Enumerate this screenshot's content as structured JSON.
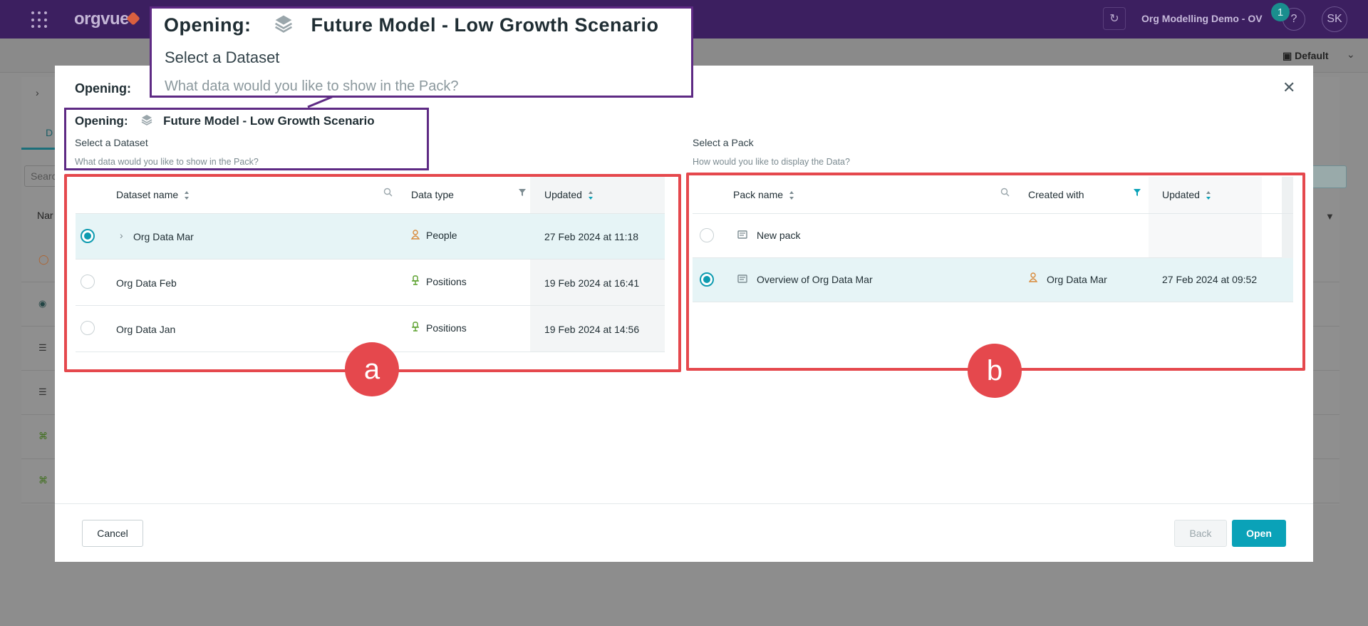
{
  "topbar": {
    "logo": "orgvue",
    "org_name": "Org Modelling Demo - OV",
    "notification_count": "1",
    "help_label": "?",
    "user_initials": "SK",
    "view_label": "Default",
    "colors": {
      "bar": "#3c1f60",
      "accent": "#0aa2b8"
    }
  },
  "background": {
    "tab_label": "D",
    "search_placeholder": "Searc",
    "column_name": "Nar"
  },
  "modal": {
    "title": "Opening:",
    "opening_label": "Opening:",
    "model_name": "Future Model - Low Growth Scenario",
    "dataset_section": {
      "title": "Select a Dataset",
      "subtitle": "What data would you like to show in the Pack?"
    },
    "pack_section": {
      "title": "Select a Pack",
      "subtitle": "How would you like to display the Data?"
    },
    "dataset_table": {
      "headers": {
        "name": "Dataset name",
        "type": "Data type",
        "updated": "Updated"
      },
      "rows": [
        {
          "name": "Org Data Mar",
          "type": "People",
          "type_icon": "person-icon",
          "updated": "27 Feb 2024 at 11:18",
          "selected": true,
          "expandable": true
        },
        {
          "name": "Org Data Feb",
          "type": "Positions",
          "type_icon": "chair-icon",
          "updated": "19 Feb 2024 at 16:41",
          "selected": false,
          "expandable": false
        },
        {
          "name": "Org Data Jan",
          "type": "Positions",
          "type_icon": "chair-icon",
          "updated": "19 Feb 2024 at 14:56",
          "selected": false,
          "expandable": false
        }
      ]
    },
    "pack_table": {
      "headers": {
        "name": "Pack name",
        "created": "Created with",
        "updated": "Updated"
      },
      "rows": [
        {
          "name": "New pack",
          "created": "",
          "updated": "",
          "selected": false
        },
        {
          "name": "Overview of Org Data Mar",
          "created": "Org Data Mar",
          "updated": "27 Feb 2024 at 09:52",
          "selected": true
        }
      ]
    },
    "callouts": {
      "a": "a",
      "b": "b"
    },
    "buttons": {
      "cancel": "Cancel",
      "back": "Back",
      "open": "Open"
    }
  }
}
